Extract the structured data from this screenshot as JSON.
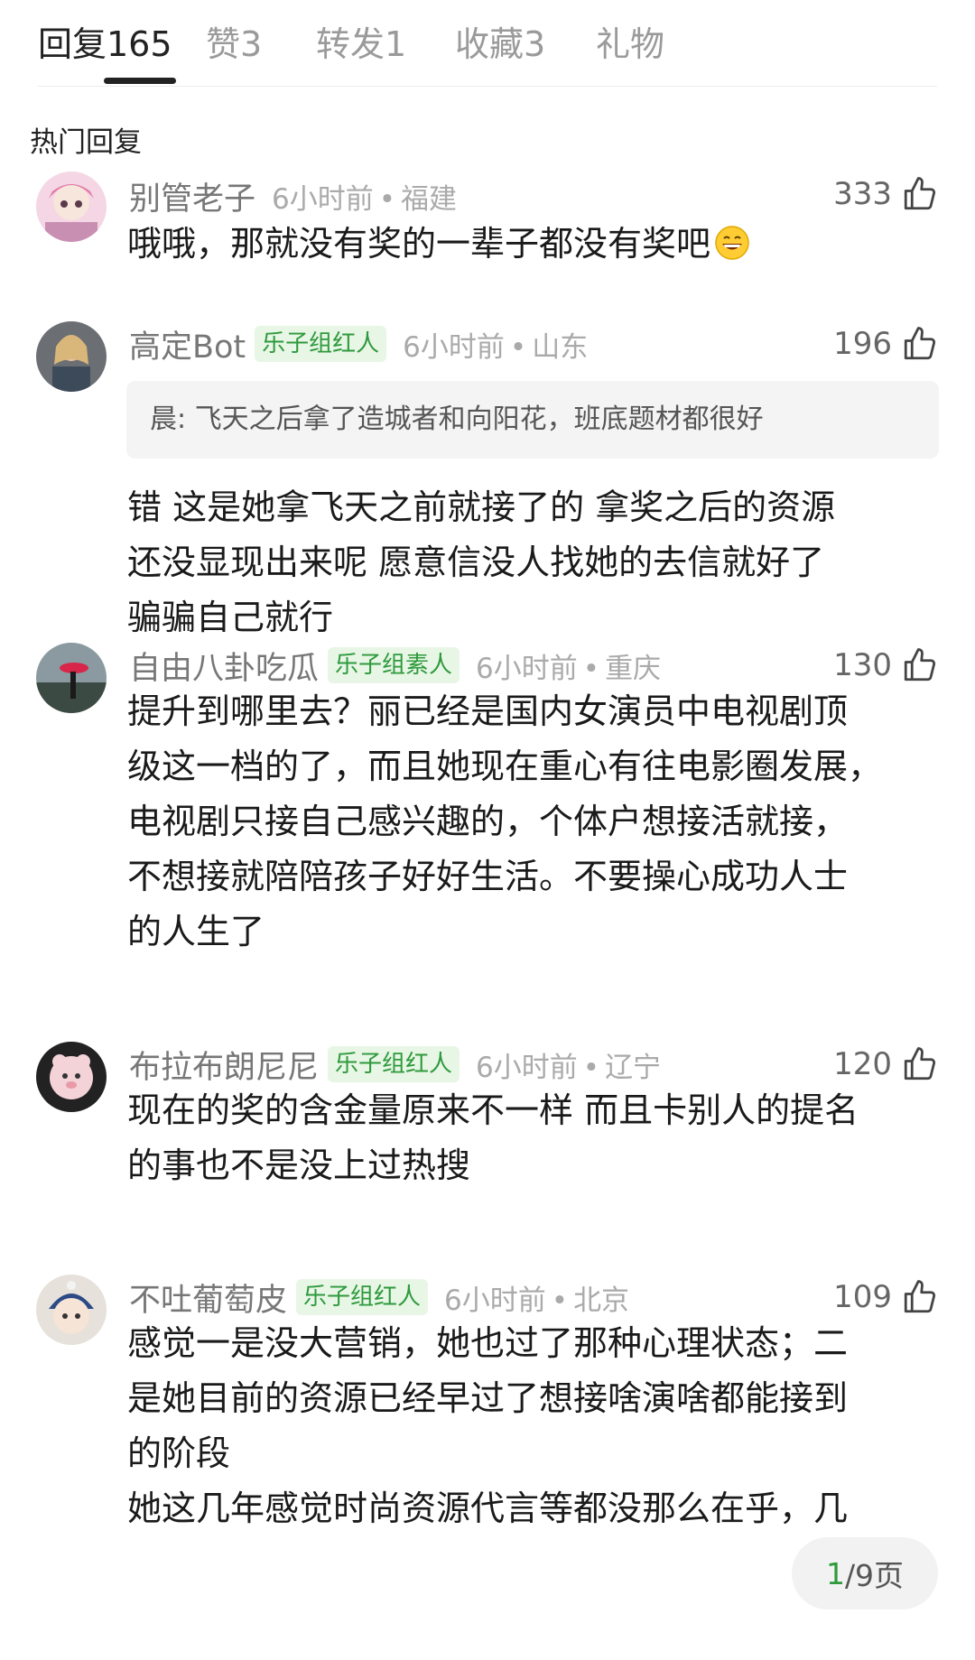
{
  "tabs": [
    {
      "label": "回复165"
    },
    {
      "label": "赞3"
    },
    {
      "label": "转发1"
    },
    {
      "label": "收藏3"
    },
    {
      "label": "礼物"
    }
  ],
  "section_title": "热门回复",
  "comments": [
    {
      "username": "别管老子",
      "badge": "",
      "time": "6小时前",
      "location": "福建",
      "likes": "333",
      "quote": "",
      "text": "哦哦，那就没有奖的一辈子都没有奖吧",
      "emoji": "grinning-emoji"
    },
    {
      "username": "高定Bot",
      "badge": "乐子组红人",
      "time": "6小时前",
      "location": "山东",
      "likes": "196",
      "quote": "晨: 飞天之后拿了造城者和向阳花，班底题材都很好",
      "text": "错 这是她拿飞天之前就接了的 拿奖之后的资源\n还没显现出来呢 愿意信没人找她的去信就好了\n骗骗自己就行"
    },
    {
      "username": "自由八卦吃瓜",
      "badge": "乐子组素人",
      "time": "6小时前",
      "location": "重庆",
      "likes": "130",
      "quote": "",
      "text": "提升到哪里去？丽已经是国内女演员中电视剧顶\n级这一档的了，而且她现在重心有往电影圈发展，\n电视剧只接自己感兴趣的，个体户想接活就接，\n不想接就陪陪孩子好好生活。不要操心成功人士\n的人生了"
    },
    {
      "username": "布拉布朗尼尼",
      "badge": "乐子组红人",
      "time": "6小时前",
      "location": "辽宁",
      "likes": "120",
      "quote": "",
      "text": "现在的奖的含金量原来不一样 而且卡别人的提名\n的事也不是没上过热搜"
    },
    {
      "username": "不吐葡萄皮",
      "badge": "乐子组红人",
      "time": "6小时前",
      "location": "北京",
      "likes": "109",
      "quote": "",
      "text": "感觉一是没大营销，她也过了那种心理状态；二\n是她目前的资源已经早过了想接啥演啥都能接到\n的阶段\n她这几年感觉时尚资源代言等都没那么在乎，几"
    }
  ],
  "pager": {
    "current": "1",
    "total": "/9页"
  },
  "colors": {
    "badge_text": "#2e9a3c",
    "badge_bg": "#e8f6e6",
    "meta": "#aaaaaa"
  }
}
